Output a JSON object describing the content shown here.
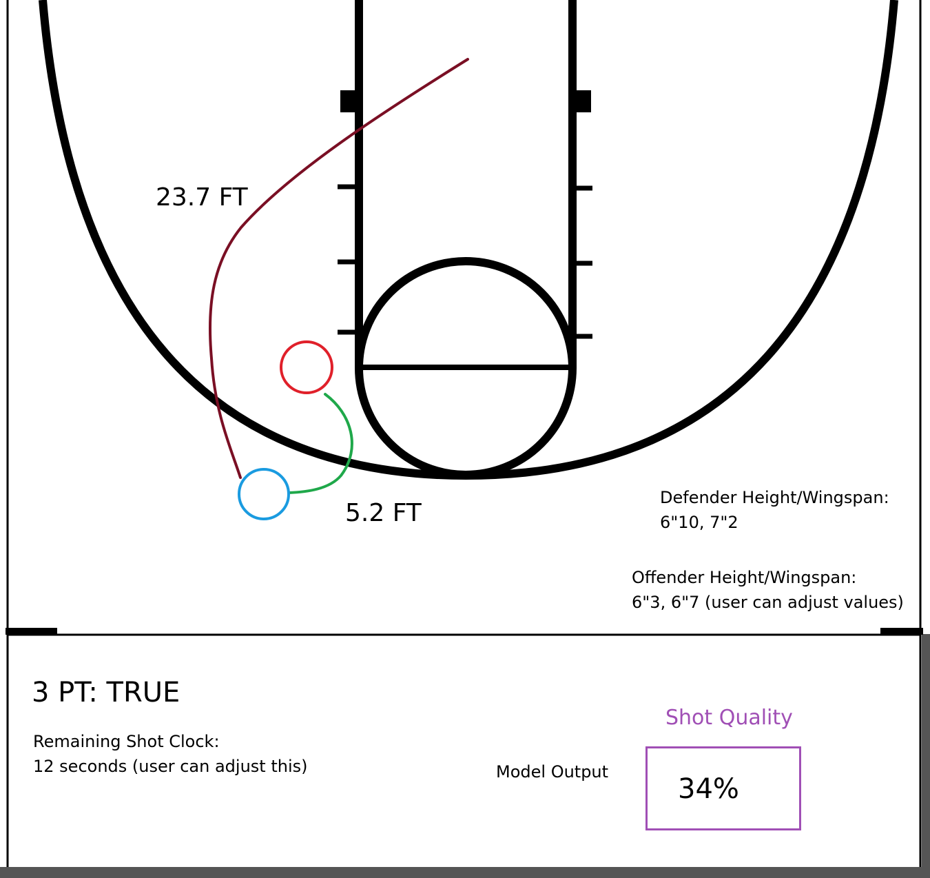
{
  "diagram": {
    "three_point_distance": "23.7 FT",
    "closeout_distance": "5.2 FT",
    "defender": {
      "label": "Defender Height/Wingspan:",
      "value": "6\"10, 7\"2"
    },
    "offender": {
      "label": "Offender Height/Wingspan:",
      "value": "6\"3, 6\"7 (user can adjust values)"
    },
    "three_pt": "3 PT: TRUE",
    "shot_clock": {
      "label": "Remaining Shot Clock:",
      "value": "12 seconds (user can adjust this)"
    },
    "model_output_label": "Model Output",
    "shot_quality": {
      "title": "Shot Quality",
      "value": "34%"
    }
  },
  "colors": {
    "three_point_path": "#7a0f24",
    "defender_circle": "#e0202a",
    "offender_circle": "#1a9be0",
    "closeout_path": "#1fa84a",
    "shot_quality_accent": "#a04fb5"
  }
}
